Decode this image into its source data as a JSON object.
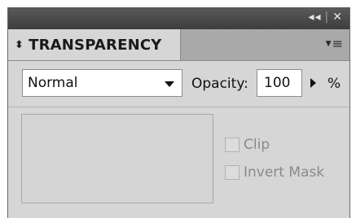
{
  "panel": {
    "tab_title": "TRANSPARENCY",
    "tab_icon": "updown-arrows-icon",
    "collapse_glyph": "◂◂",
    "close_glyph": "✕",
    "menu_icon": "panel-menu-icon"
  },
  "controls": {
    "blend_mode": "Normal",
    "opacity_label": "Opacity:",
    "opacity_value": "100",
    "percent": "%"
  },
  "options": {
    "clip_label": "Clip",
    "invert_mask_label": "Invert Mask",
    "clip_checked": false,
    "invert_mask_checked": false
  },
  "colors": {
    "titlebar": "#4a4a4a",
    "panel_bg": "#d6d6d6",
    "tabrow_bg": "#a9a9a9",
    "disabled_text": "#8a8a8a"
  }
}
